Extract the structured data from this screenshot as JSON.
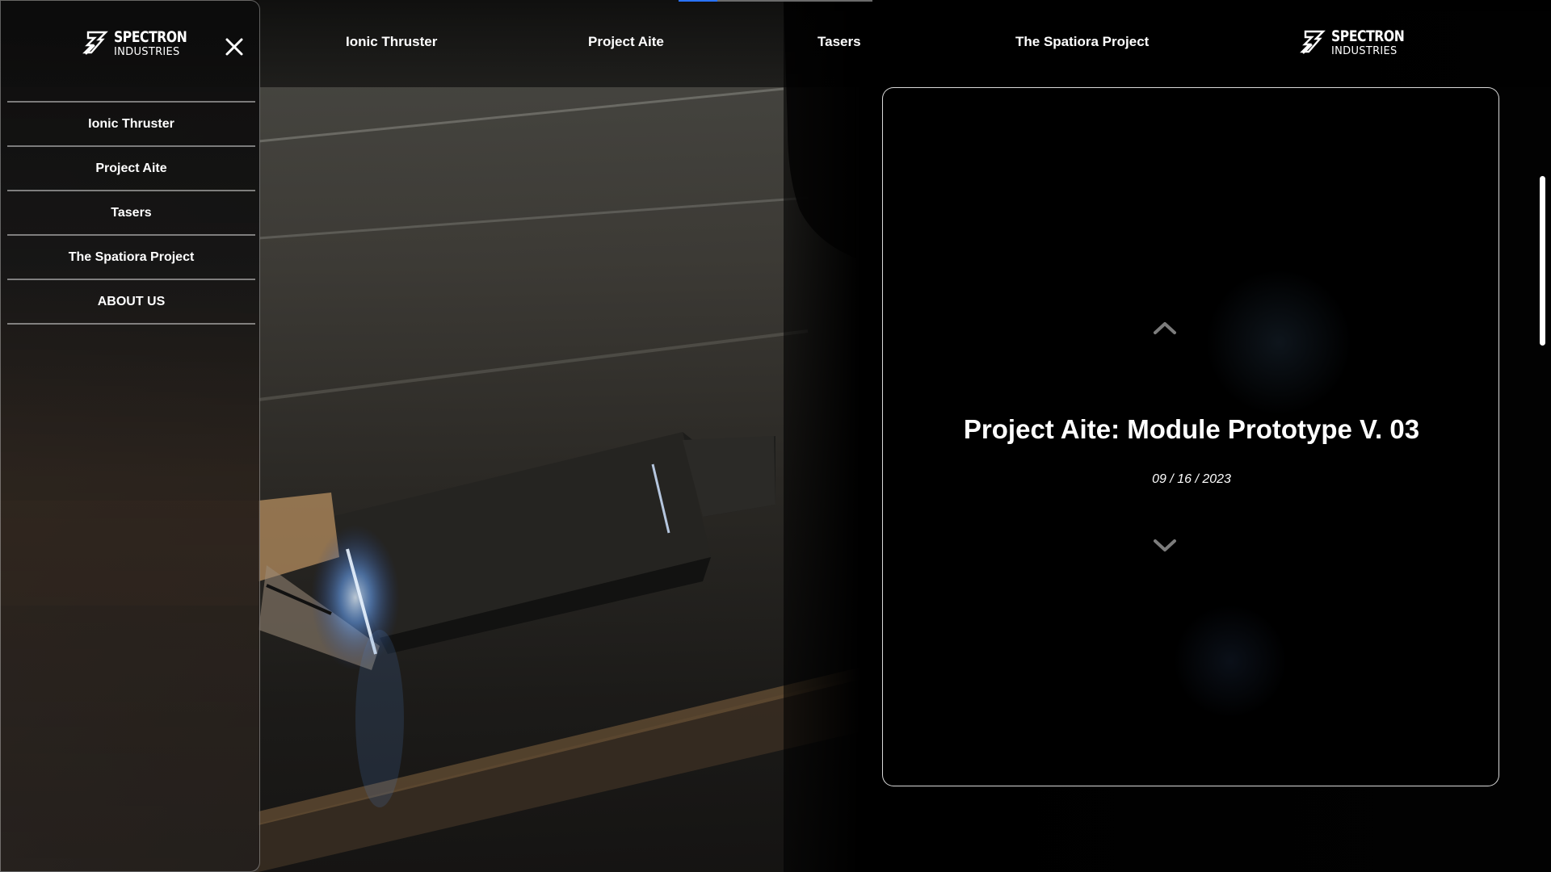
{
  "brand": {
    "word1": "SPECTRON",
    "word2": "INDUSTRIES"
  },
  "topnav": {
    "links": [
      {
        "label": "Ionic Thruster"
      },
      {
        "label": "Project Aite"
      },
      {
        "label": "Tasers"
      },
      {
        "label": "The Spatiora Project"
      }
    ],
    "progress_fraction": 0.2
  },
  "drawer": {
    "items": [
      {
        "label": "Ionic Thruster"
      },
      {
        "label": "Project Aite"
      },
      {
        "label": "Tasers"
      },
      {
        "label": "The Spatiora Project"
      },
      {
        "label": "ABOUT US"
      }
    ]
  },
  "card": {
    "title": "Project Aite: Module Prototype V. 03",
    "date": "09 / 16 / 2023"
  },
  "icons": {
    "close": "close-icon",
    "up": "chevron-up-icon",
    "down": "chevron-down-icon",
    "logo": "spectron-logo-mark"
  },
  "colors": {
    "accent": "#2a73ff",
    "text": "#ffffff",
    "background": "#000000"
  }
}
